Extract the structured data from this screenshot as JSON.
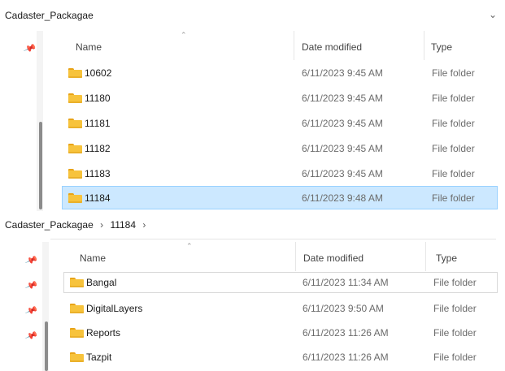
{
  "top_pane": {
    "breadcrumb": "Cadaster_Packagae",
    "columns": {
      "name": "Name",
      "date": "Date modified",
      "type": "Type"
    },
    "rows": [
      {
        "name": "10602",
        "date": "6/11/2023 9:45 AM",
        "type": "File folder"
      },
      {
        "name": "11180",
        "date": "6/11/2023 9:45 AM",
        "type": "File folder"
      },
      {
        "name": "11181",
        "date": "6/11/2023 9:45 AM",
        "type": "File folder"
      },
      {
        "name": "11182",
        "date": "6/11/2023 9:45 AM",
        "type": "File folder"
      },
      {
        "name": "11183",
        "date": "6/11/2023 9:45 AM",
        "type": "File folder"
      },
      {
        "name": "11184",
        "date": "6/11/2023 9:48 AM",
        "type": "File folder",
        "selected": true
      }
    ]
  },
  "bottom_pane": {
    "breadcrumb": [
      "Cadaster_Packagae",
      "11184"
    ],
    "columns": {
      "name": "Name",
      "date": "Date modified",
      "type": "Type"
    },
    "rows": [
      {
        "name": "Bangal",
        "date": "6/11/2023 11:34 AM",
        "type": "File folder"
      },
      {
        "name": "DigitalLayers",
        "date": "6/11/2023 9:50 AM",
        "type": "File folder"
      },
      {
        "name": "Reports",
        "date": "6/11/2023 11:26 AM",
        "type": "File folder"
      },
      {
        "name": "Tazpit",
        "date": "6/11/2023 11:26 AM",
        "type": "File folder"
      }
    ]
  },
  "icons": {
    "breadcrumb_separator": "›",
    "dropdown": "chevron-down-icon",
    "sort": "sort-up-caret-icon",
    "pin": "pin-icon",
    "folder": "folder-icon"
  },
  "colors": {
    "selection_bg": "#cce8ff",
    "selection_border": "#99d1ff",
    "folder": "#f7c33c"
  }
}
